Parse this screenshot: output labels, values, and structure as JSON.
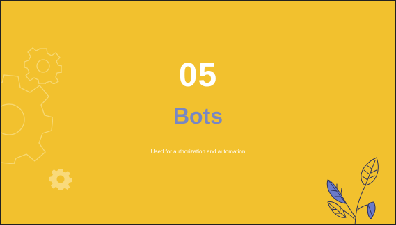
{
  "slide": {
    "number": "05",
    "title": "Bots",
    "subtitle": "Used for authorization and automation"
  },
  "decorations": {
    "outline_gear_small": "gear-outline-icon",
    "outline_gear_large": "gear-outline-icon",
    "solid_gear": "gear-icon",
    "plant": "leaf-plant-icon"
  },
  "colors": {
    "background": "#F2C12E",
    "title": "#7887C4",
    "number": "#FFFFFF",
    "leaf_blue": "#6B7BC9",
    "leaf_yellow": "#F2C12E",
    "outline": "#2B2F5C",
    "deco_outline": "#F7D873"
  }
}
